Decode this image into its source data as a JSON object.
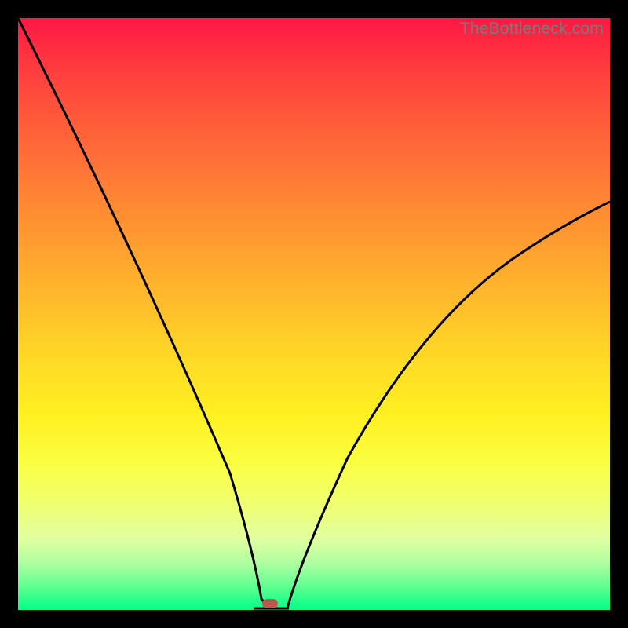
{
  "watermark": "TheBottleneck.com",
  "colors": {
    "frame": "#000000",
    "marker": "#c1564e",
    "curve": "#000000"
  },
  "chart_data": {
    "type": "line",
    "title": "",
    "xlabel": "",
    "ylabel": "",
    "xlim": [
      0,
      100
    ],
    "ylim": [
      0,
      100
    ],
    "series": [
      {
        "name": "left-branch",
        "x": [
          0,
          5,
          10,
          15,
          20,
          25,
          30,
          35,
          38,
          40,
          41
        ],
        "y": [
          100,
          89,
          77,
          66,
          54,
          41,
          28,
          14,
          5,
          1,
          0
        ]
      },
      {
        "name": "right-branch",
        "x": [
          45,
          47,
          50,
          55,
          60,
          65,
          70,
          75,
          80,
          85,
          90,
          95,
          100
        ],
        "y": [
          0,
          2,
          7,
          16,
          24,
          32,
          39,
          45,
          51,
          56,
          61,
          65,
          69
        ]
      }
    ],
    "annotations": [
      {
        "name": "marker",
        "x": 42.5,
        "y": 0
      }
    ]
  }
}
